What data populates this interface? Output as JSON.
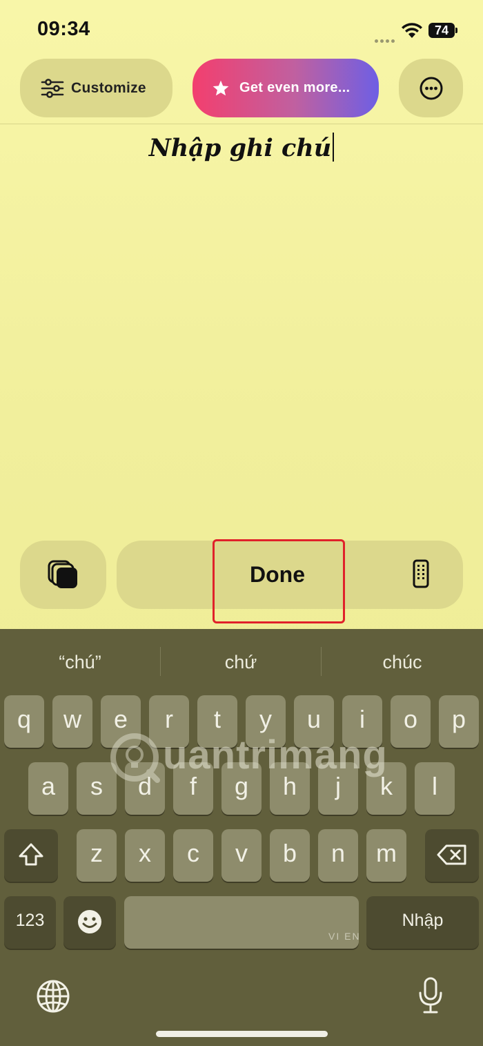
{
  "status": {
    "time": "09:34",
    "battery": "74"
  },
  "toolbar": {
    "customize_label": "Customize",
    "get_more_label": "Get even more..."
  },
  "note": {
    "text": "Nhập ghi chú"
  },
  "bottom_bar": {
    "done_label": "Done"
  },
  "keyboard": {
    "suggestions": [
      "“chú”",
      "chứ",
      "chúc"
    ],
    "row1": [
      "q",
      "w",
      "e",
      "r",
      "t",
      "y",
      "u",
      "i",
      "o",
      "p"
    ],
    "row2": [
      "a",
      "s",
      "d",
      "f",
      "g",
      "h",
      "j",
      "k",
      "l"
    ],
    "row3": [
      "z",
      "x",
      "c",
      "v",
      "b",
      "n",
      "m"
    ],
    "numbers_label": "123",
    "return_label": "Nhập",
    "language_indicator": "VI EN"
  },
  "watermark": {
    "text": "uantrimang"
  },
  "colors": {
    "accent_start": "#f33f6e",
    "accent_end": "#6e5fe4",
    "highlight": "#e0212a",
    "note_bg": "#f3f1a0",
    "keyboard_bg": "#615f3c"
  },
  "icons": [
    "sliders-icon",
    "star-icon",
    "ellipsis-icon",
    "layers-icon",
    "phone-grid-icon",
    "shift-icon",
    "backspace-icon",
    "emoji-icon",
    "globe-icon",
    "microphone-icon",
    "wifi-icon",
    "battery-icon"
  ]
}
